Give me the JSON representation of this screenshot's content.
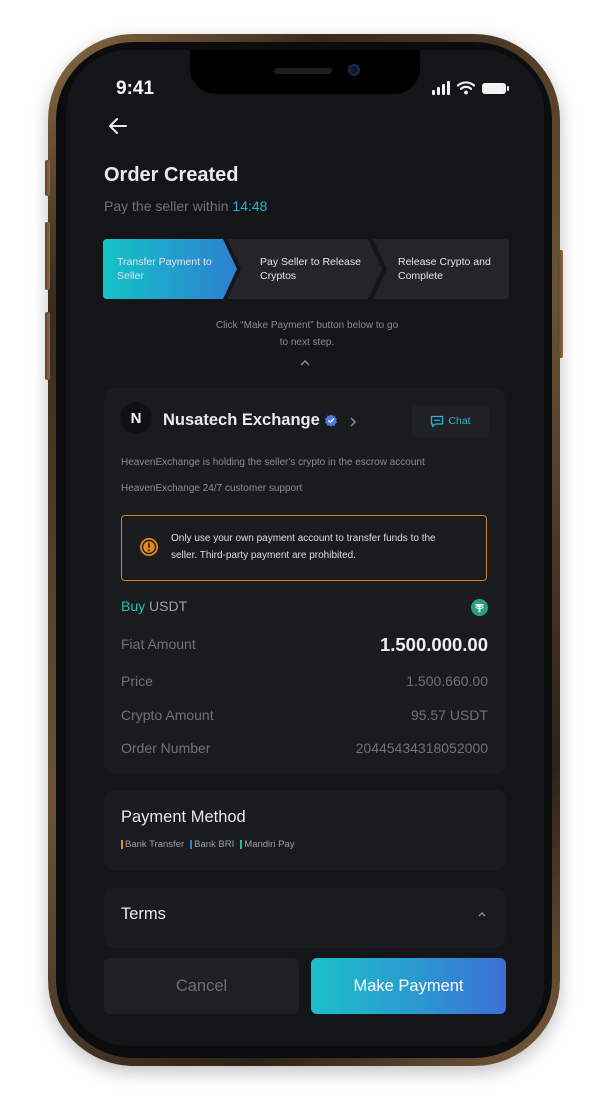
{
  "status_bar": {
    "time": "9:41"
  },
  "header": {
    "title": "Order Created",
    "subtitle_prefix": "Pay the seller within",
    "timer": "14:48"
  },
  "steps": [
    {
      "line1": "Transfer Payment to",
      "line2": "Seller"
    },
    {
      "line1": "Pay Seller to Release",
      "line2": "Cryptos"
    },
    {
      "line1": "Release Crypto and",
      "line2": "Complete"
    }
  ],
  "hint": {
    "line1": "Click “Make Payment” button below to go",
    "line2": "to next step."
  },
  "merchant": {
    "avatar_letter": "N",
    "name": "Nusatech Exchange",
    "chat_label": "Chat",
    "escrow_text": "HeavenExchange is holding the seller's crypto in the escrow account",
    "support_text": "HeavenExchange 24/7 customer support"
  },
  "warning": {
    "line1": "Only use your own payment account to transfer funds to the",
    "line2": "seller. Third-party payment are prohibited."
  },
  "order": {
    "buy_label": "Buy",
    "asset": "USDT",
    "rows": [
      {
        "label": "Fiat Amount",
        "value": "1.500.000.00"
      },
      {
        "label": "Price",
        "value": "1.500.660.00"
      },
      {
        "label": "Crypto Amount",
        "value": "95.57 USDT"
      },
      {
        "label": "Order Number",
        "value": "20445434318052000"
      }
    ]
  },
  "payment_method": {
    "title": "Payment Method",
    "methods": [
      {
        "name": "Bank Transfer",
        "color": "#e0892a"
      },
      {
        "name": "Bank BRI",
        "color": "#2f7fd6"
      },
      {
        "name": "Mandiri Pay",
        "color": "#1fbf9a"
      }
    ]
  },
  "terms": {
    "title": "Terms"
  },
  "actions": {
    "cancel": "Cancel",
    "pay": "Make Payment"
  },
  "colors": {
    "accent": "#1fb3d4",
    "teal": "#19c4b4",
    "warning": "#e08a1e",
    "background": "#141518"
  }
}
